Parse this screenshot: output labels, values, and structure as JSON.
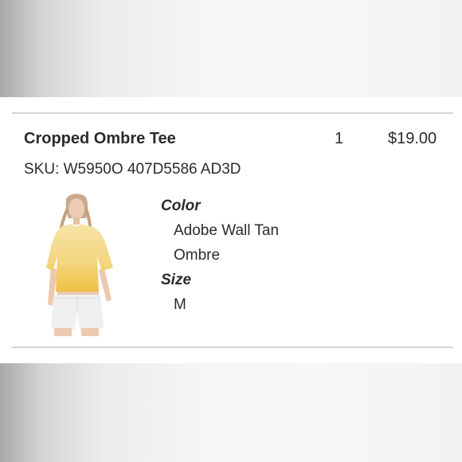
{
  "order_item": {
    "name": "Cropped Ombre Tee",
    "quantity": "1",
    "price": "$19.00",
    "sku": "SKU: W5950O 407D5586 AD3D",
    "image_icon": "product-photo-cropped-tee",
    "attributes": {
      "color_label": "Color",
      "color_value_line1": "Adobe Wall Tan",
      "color_value_line2": "Ombre",
      "size_label": "Size",
      "size_value": "M"
    }
  },
  "colors": {
    "text": "#2b2b2b",
    "divider": "#d6d6d6",
    "tee_top": "#f3d98a",
    "tee_bottom": "#f0c24a"
  }
}
